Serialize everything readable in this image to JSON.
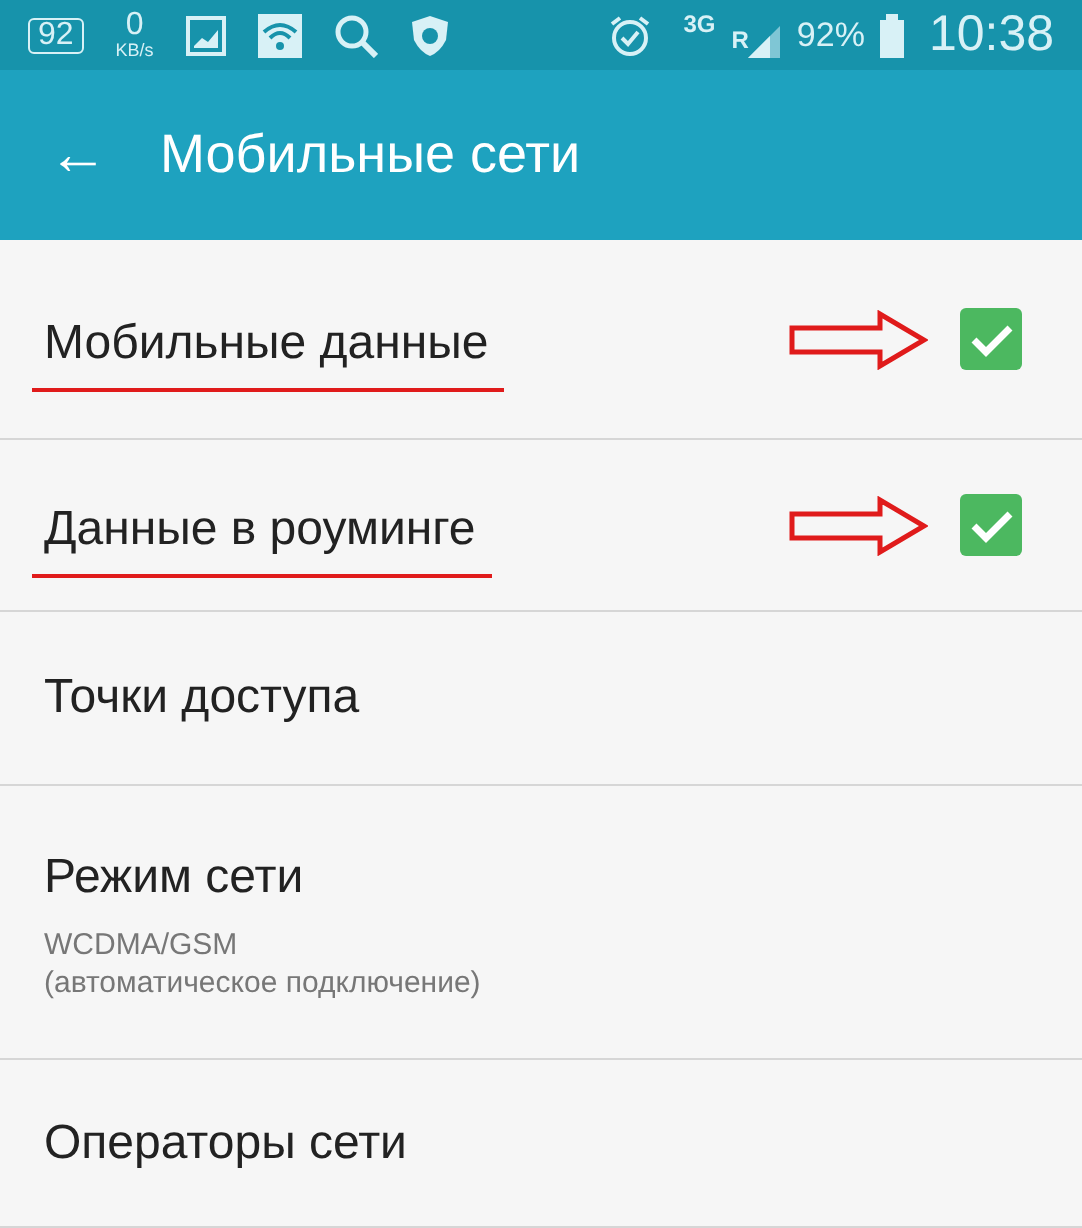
{
  "status_bar": {
    "left": [
      {
        "kind": "boxed",
        "text": "92"
      },
      {
        "kind": "speed",
        "text": "0",
        "unit": "KB/s"
      },
      {
        "kind": "gallery"
      },
      {
        "kind": "wifi"
      },
      {
        "kind": "search"
      },
      {
        "kind": "shield"
      }
    ],
    "alarm": true,
    "network": "3G",
    "roaming": "R",
    "battery": "92%",
    "time": "10:38"
  },
  "app_bar": {
    "back": "←",
    "title": "Мобильные сети"
  },
  "items": [
    {
      "kind": "checkbox",
      "label": "Мобильные данные",
      "checked": true,
      "annotated": true
    },
    {
      "kind": "checkbox",
      "label": "Данные в роуминге",
      "checked": true,
      "annotated": true
    },
    {
      "kind": "plain",
      "label": "Точки доступа"
    },
    {
      "kind": "subtitle",
      "label": "Режим сети",
      "summary": [
        "WCDMA/GSM",
        "(автоматическое подключение)"
      ]
    },
    {
      "kind": "plain",
      "label": "Операторы сети"
    }
  ]
}
